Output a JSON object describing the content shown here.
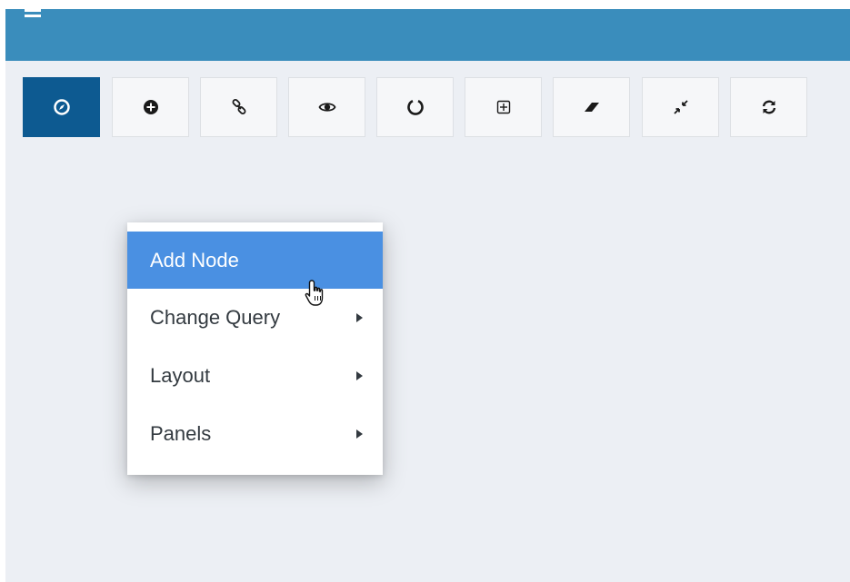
{
  "topbar": {
    "menu_icon": "hamburger-icon",
    "color": "#3a8dbc"
  },
  "toolbar": {
    "buttons": [
      {
        "name": "compass-button",
        "icon": "compass-icon",
        "active": true
      },
      {
        "name": "add-button",
        "icon": "plus-circle-icon"
      },
      {
        "name": "link-button",
        "icon": "link-icon"
      },
      {
        "name": "visibility-button",
        "icon": "eye-icon"
      },
      {
        "name": "circle-layout-button",
        "icon": "circle-icon"
      },
      {
        "name": "expand-button",
        "icon": "plus-square-icon"
      },
      {
        "name": "eraser-button",
        "icon": "eraser-icon"
      },
      {
        "name": "collapse-button",
        "icon": "compress-icon"
      },
      {
        "name": "refresh-button",
        "icon": "refresh-icon"
      }
    ],
    "active_color": "#0d5a91"
  },
  "context_menu": {
    "items": [
      {
        "label": "Add Node",
        "submenu": false,
        "highlighted": true
      },
      {
        "label": "Change Query",
        "submenu": true
      },
      {
        "label": "Layout",
        "submenu": true
      },
      {
        "label": "Panels",
        "submenu": true
      }
    ],
    "highlight_color": "#4a90e2"
  }
}
